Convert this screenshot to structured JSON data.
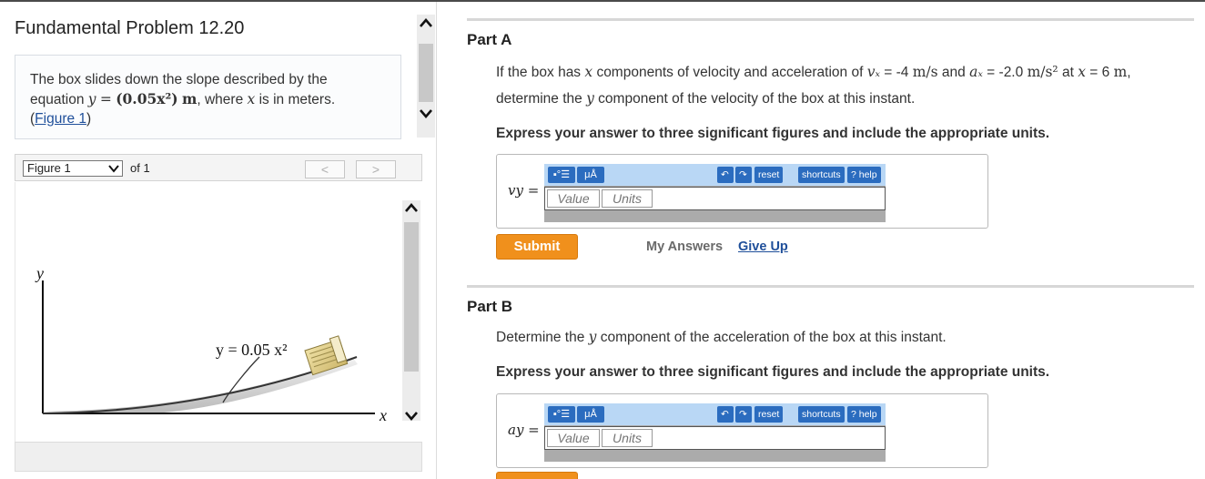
{
  "problem": {
    "title": "Fundamental Problem 12.20",
    "text_1": "The box slides down the slope described by the",
    "text_2": "equation",
    "eq_y": "y",
    "eq_equals": "=",
    "eq_expr": "(0.05x²)",
    "eq_unit": "m",
    "text_3": ", where",
    "var_x": "x",
    "text_4": "is in meters.",
    "figure_link_open": "(",
    "figure_link": "Figure 1",
    "figure_link_close": ")"
  },
  "figure_nav": {
    "selected": "Figure 1",
    "of_text": "of 1",
    "prev": "<",
    "next": ">"
  },
  "figure": {
    "y_axis_label": "y",
    "x_axis_label": "x",
    "curve_label": "y = 0.05 x²"
  },
  "part_a": {
    "title": "Part A",
    "q_1": "If the box has",
    "q_x": "x",
    "q_2": "components of velocity and acceleration of",
    "q_vx": "vₓ",
    "q_3": "= -4",
    "q_u1": "m/s",
    "q_4": "and",
    "q_ax": "aₓ",
    "q_5": "= -2.0",
    "q_u2": "m/s²",
    "q_6": "at",
    "q_x2": "x",
    "q_7": "= 6",
    "q_u3": "m",
    "q_8": ",",
    "q_line2_a": "determine the",
    "q_line2_y": "y",
    "q_line2_b": "component of the velocity of the box at this instant.",
    "instruction": "Express your answer to three significant figures and include the appropriate units.",
    "answer_label": "vy =",
    "value_placeholder": "Value",
    "units_placeholder": "Units",
    "submit": "Submit",
    "my_answers": "My Answers",
    "give_up": "Give Up"
  },
  "part_b": {
    "title": "Part B",
    "q_a": "Determine the",
    "q_y": "y",
    "q_b": "component of the acceleration of the box at this instant.",
    "instruction": "Express your answer to three significant figures and include the appropriate units.",
    "answer_label": "ay =",
    "value_placeholder": "Value",
    "units_placeholder": "Units"
  },
  "toolbar": {
    "templates_label": "▪°☰",
    "units_label": "μÅ",
    "undo_icon": "undo-icon",
    "redo_icon": "redo-icon",
    "reset": "reset",
    "shortcuts": "shortcuts",
    "help": "? help"
  },
  "colors": {
    "accent_blue": "#2b6cbf",
    "toolbar_bg": "#b9d7f5",
    "submit_orange": "#f0901c",
    "link_blue": "#1f4f9a"
  }
}
